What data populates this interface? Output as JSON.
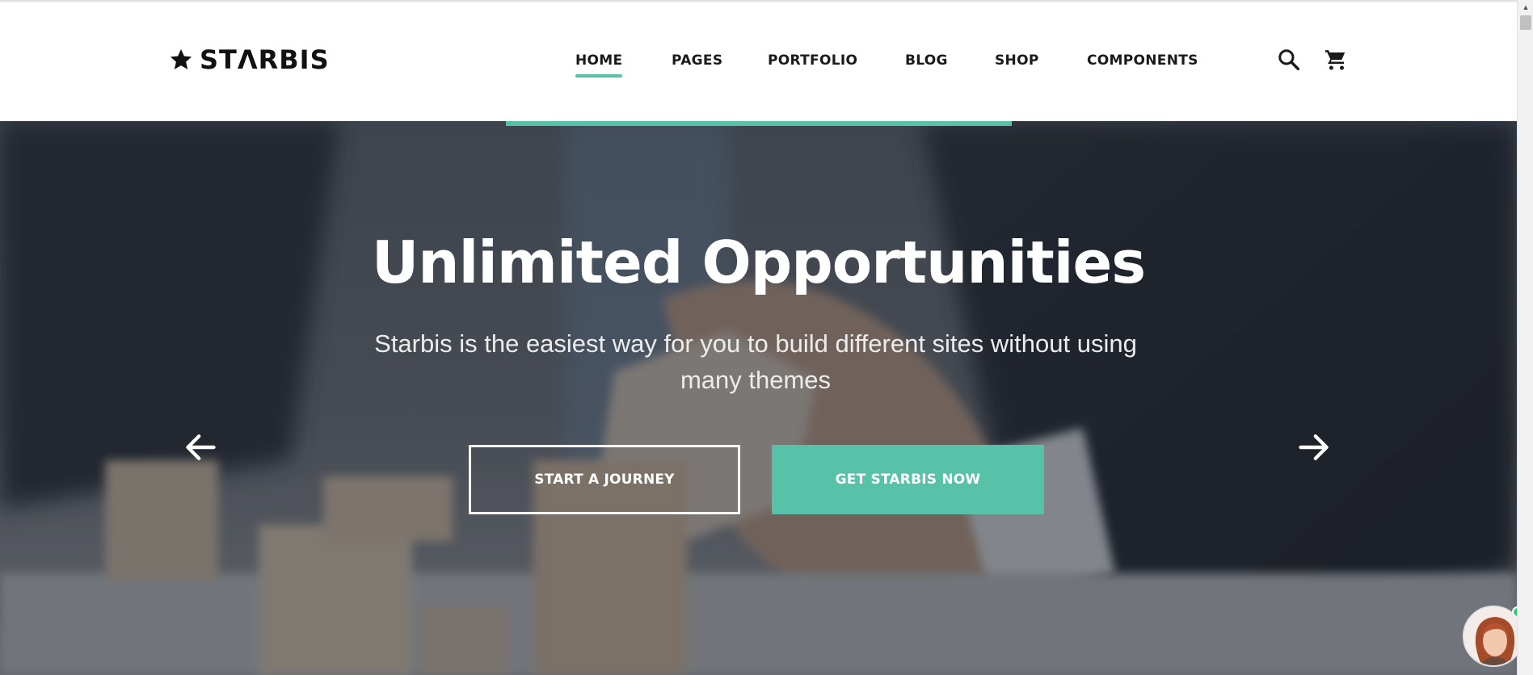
{
  "brand": {
    "name": "STΛRBIS",
    "accent_color": "#57c2a7"
  },
  "nav": {
    "items": [
      {
        "label": "HOME",
        "active": true
      },
      {
        "label": "PAGES",
        "active": false
      },
      {
        "label": "PORTFOLIO",
        "active": false
      },
      {
        "label": "BLOG",
        "active": false
      },
      {
        "label": "SHOP",
        "active": false
      },
      {
        "label": "COMPONENTS",
        "active": false
      }
    ],
    "icons": [
      "search-icon",
      "cart-icon"
    ]
  },
  "hero": {
    "title": "Unlimited Opportunities",
    "subtitle": "Starbis is the easiest way for you to build different sites without using many themes",
    "primary_button": "GET STARBIS NOW",
    "secondary_button": "START A JOURNEY",
    "prev_icon": "arrow-left-icon",
    "next_icon": "arrow-right-icon"
  },
  "chat": {
    "status": "online",
    "status_color": "#2ecc71"
  }
}
